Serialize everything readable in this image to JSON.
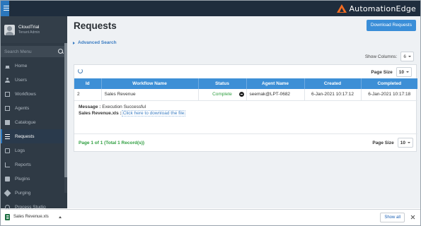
{
  "brand": {
    "name": "AutomationEdge"
  },
  "user": {
    "name": "CloudTrial",
    "role": "Tenant Admin"
  },
  "search": {
    "placeholder": "Search Menu"
  },
  "sidebar": {
    "items": [
      {
        "label": "Home",
        "icon": "home-icon"
      },
      {
        "label": "Users",
        "icon": "users-icon"
      },
      {
        "label": "Workflows",
        "icon": "workflows-icon"
      },
      {
        "label": "Agents",
        "icon": "monitor-icon"
      },
      {
        "label": "Catalogue",
        "icon": "book-icon"
      },
      {
        "label": "Requests",
        "icon": "list-icon"
      },
      {
        "label": "Logs",
        "icon": "logs-icon"
      },
      {
        "label": "Reports",
        "icon": "chart-icon"
      },
      {
        "label": "Plugins",
        "icon": "plug-icon"
      },
      {
        "label": "Purging",
        "icon": "tag-icon"
      },
      {
        "label": "Process Studio",
        "icon": "gear-icon"
      }
    ],
    "active": "Requests"
  },
  "page": {
    "title": "Requests",
    "download_button": "Download Requests",
    "advanced_search": "Advanced Search",
    "show_columns_label": "Show Columns:",
    "show_columns_value": "6"
  },
  "table": {
    "page_size_label": "Page Size",
    "page_size_value": "10",
    "columns": [
      "Id",
      "Workflow Name",
      "Status",
      "Agent Name",
      "Created",
      "Completed"
    ],
    "rows": [
      {
        "id": "2",
        "workflow": "Sales Revenue",
        "status": "Complete",
        "agent": "seemak@LPT-0682",
        "created": "6-Jan-2021 10:17:12",
        "completed": "6-Jan-2021 10:17:18"
      }
    ],
    "detail": {
      "message_label": "Message :",
      "message_value": "Execution Successful",
      "file_label": "Sales Revenue.xls :",
      "file_link": "Click here to download the file"
    },
    "page_info": "Page 1 of 1 (Total 1 Record(s))"
  },
  "shelf": {
    "file_name": "Sales Revenue.xls",
    "show_all": "Show all"
  },
  "colors": {
    "topbar": "#1f2d3d",
    "sidebar": "#2f3a45",
    "accent": "#3d8fd6",
    "brand_orange": "#f26b21",
    "status_green": "#2e9e3f"
  }
}
